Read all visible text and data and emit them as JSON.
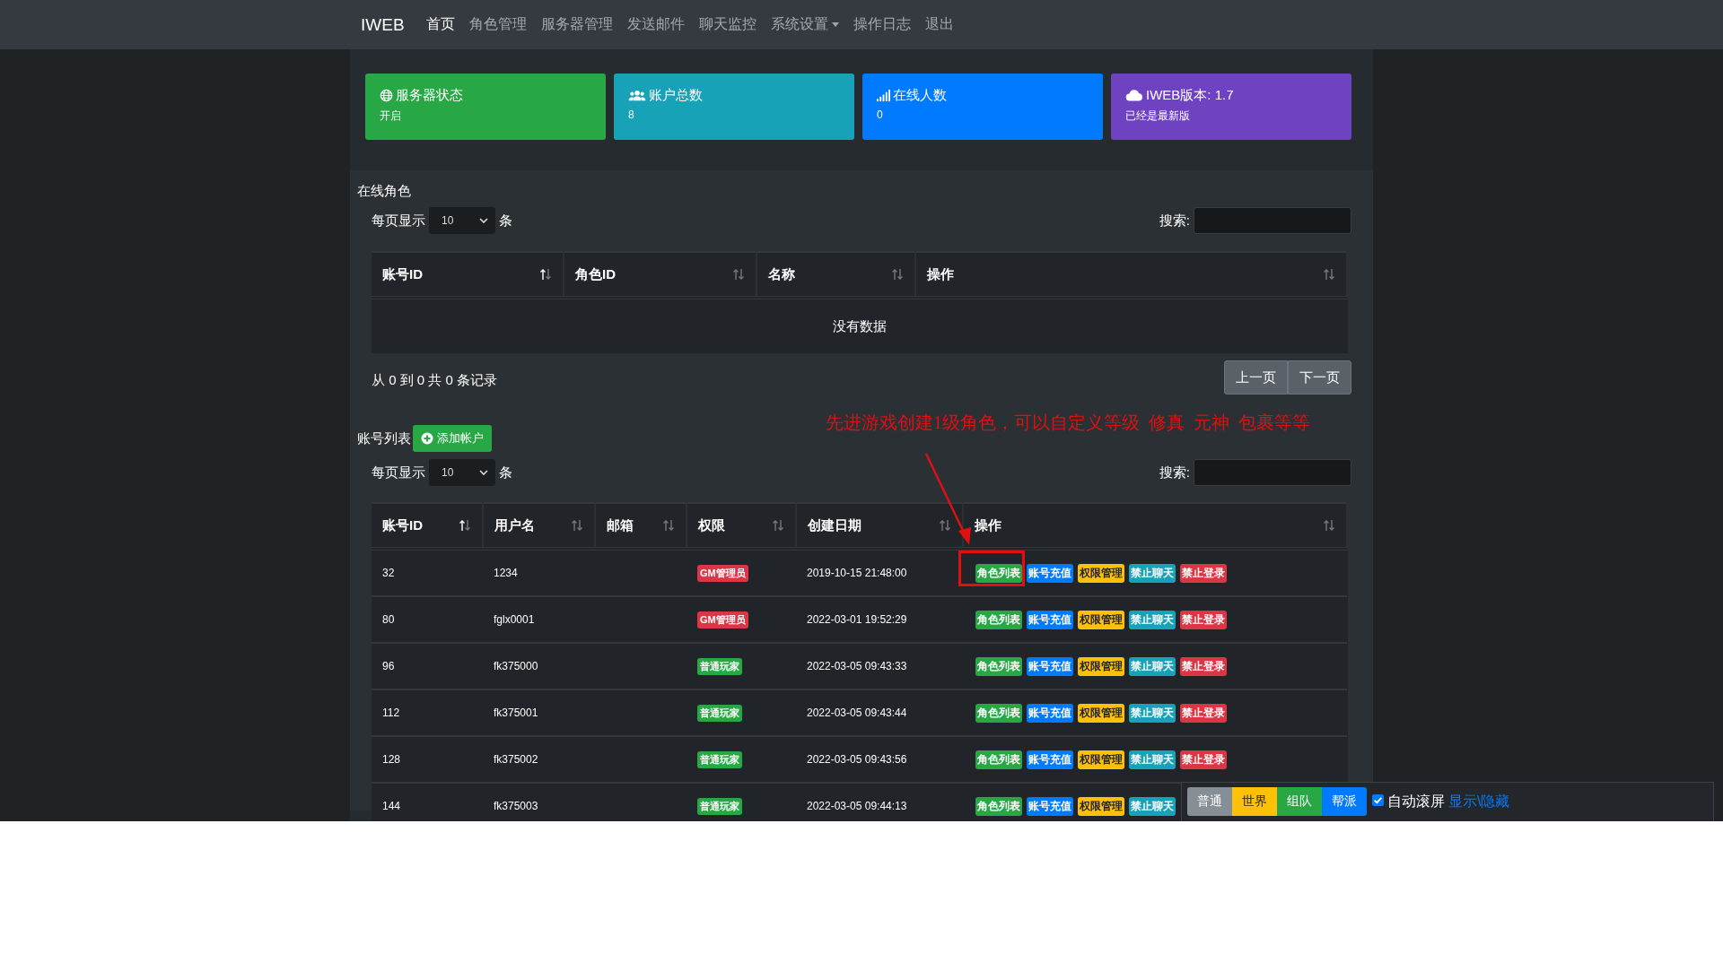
{
  "nav": {
    "brand": "IWEB",
    "items": [
      {
        "label": "首页",
        "selected": true,
        "dropdown": false
      },
      {
        "label": "角色管理",
        "selected": false,
        "dropdown": false
      },
      {
        "label": "服务器管理",
        "selected": false,
        "dropdown": false
      },
      {
        "label": "发送邮件",
        "selected": false,
        "dropdown": false
      },
      {
        "label": "聊天监控",
        "selected": false,
        "dropdown": false
      },
      {
        "label": "系统设置",
        "selected": false,
        "dropdown": true
      },
      {
        "label": "操作日志",
        "selected": false,
        "dropdown": false
      },
      {
        "label": "退出",
        "selected": false,
        "dropdown": false
      }
    ]
  },
  "cards": [
    {
      "kind": "globe",
      "title": "服务器状态",
      "value": "开启",
      "color": "#28a745"
    },
    {
      "kind": "users",
      "title": "账户总数",
      "value": "8",
      "color": "#17a2b8"
    },
    {
      "kind": "signal",
      "title": "在线人数",
      "value": "0",
      "color": "#007bff"
    },
    {
      "kind": "cloud",
      "title": "IWEB版本: 1.7",
      "value": "已经是最新版",
      "color": "#6f42c1"
    }
  ],
  "online_roles": {
    "title": "在线角色",
    "length_before": "每页显示",
    "length_value": "10",
    "length_after": "条",
    "search_label": "搜索:",
    "columns": [
      {
        "label": "账号ID",
        "sorted": true
      },
      {
        "label": "角色ID",
        "sorted": false
      },
      {
        "label": "名称",
        "sorted": false
      },
      {
        "label": "操作",
        "sorted": false
      }
    ],
    "empty": "没有数据",
    "info": "从 0 到 0 共 0 条记录",
    "buttons": [
      "上一页",
      "下一页"
    ]
  },
  "accounts": {
    "title": "账号列表",
    "add_button": "添加帐户",
    "annotation": "先进游戏创建1级角色，可以自定义等级  修真  元神  包裹等等",
    "length_before": "每页显示",
    "length_value": "10",
    "length_after": "条",
    "search_label": "搜索:",
    "columns": [
      {
        "label": "账号ID",
        "sorted": true
      },
      {
        "label": "用户名",
        "sorted": false
      },
      {
        "label": "邮箱",
        "sorted": false
      },
      {
        "label": "权限",
        "sorted": false
      },
      {
        "label": "创建日期",
        "sorted": false
      },
      {
        "label": "操作",
        "sorted": false
      }
    ],
    "rows": [
      {
        "id": "32",
        "username": "1234",
        "role": {
          "label": "GM管理员",
          "kind": "gm"
        },
        "created": "2019-10-15 21:48:00",
        "actions": [
          {
            "label": "角色列表",
            "kind": "list"
          },
          {
            "label": "账号充值",
            "kind": "recharge"
          },
          {
            "label": "权限管理",
            "kind": "permission"
          },
          {
            "label": "禁止聊天",
            "kind": "mute"
          },
          {
            "label": "禁止登录",
            "kind": "ban"
          }
        ]
      },
      {
        "id": "80",
        "username": "fglx0001",
        "role": {
          "label": "GM管理员",
          "kind": "gm"
        },
        "created": "2022-03-01 19:52:29",
        "actions": [
          {
            "label": "角色列表",
            "kind": "list"
          },
          {
            "label": "账号充值",
            "kind": "recharge"
          },
          {
            "label": "权限管理",
            "kind": "permission"
          },
          {
            "label": "禁止聊天",
            "kind": "mute"
          },
          {
            "label": "禁止登录",
            "kind": "ban"
          }
        ]
      },
      {
        "id": "96",
        "username": "fk375000",
        "role": {
          "label": "普通玩家",
          "kind": "player"
        },
        "created": "2022-03-05 09:43:33",
        "actions": [
          {
            "label": "角色列表",
            "kind": "list"
          },
          {
            "label": "账号充值",
            "kind": "recharge"
          },
          {
            "label": "权限管理",
            "kind": "permission"
          },
          {
            "label": "禁止聊天",
            "kind": "mute"
          },
          {
            "label": "禁止登录",
            "kind": "ban"
          }
        ]
      },
      {
        "id": "112",
        "username": "fk375001",
        "role": {
          "label": "普通玩家",
          "kind": "player"
        },
        "created": "2022-03-05 09:43:44",
        "actions": [
          {
            "label": "角色列表",
            "kind": "list"
          },
          {
            "label": "账号充值",
            "kind": "recharge"
          },
          {
            "label": "权限管理",
            "kind": "permission"
          },
          {
            "label": "禁止聊天",
            "kind": "mute"
          },
          {
            "label": "禁止登录",
            "kind": "ban"
          }
        ]
      },
      {
        "id": "128",
        "username": "fk375002",
        "role": {
          "label": "普通玩家",
          "kind": "player"
        },
        "created": "2022-03-05 09:43:56",
        "actions": [
          {
            "label": "角色列表",
            "kind": "list"
          },
          {
            "label": "账号充值",
            "kind": "recharge"
          },
          {
            "label": "权限管理",
            "kind": "permission"
          },
          {
            "label": "禁止聊天",
            "kind": "mute"
          },
          {
            "label": "禁止登录",
            "kind": "ban"
          }
        ]
      },
      {
        "id": "144",
        "username": "fk375003",
        "role": {
          "label": "普通玩家",
          "kind": "player"
        },
        "created": "2022-03-05 09:44:13",
        "actions": [
          {
            "label": "角色列表",
            "kind": "list"
          },
          {
            "label": "账号充值",
            "kind": "recharge"
          },
          {
            "label": "权限管理",
            "kind": "permission"
          },
          {
            "label": "禁止聊天",
            "kind": "mute"
          }
        ]
      }
    ]
  },
  "chat_bar": {
    "channels": [
      {
        "label": "普通",
        "kind": "normal"
      },
      {
        "label": "世界",
        "kind": "world"
      },
      {
        "label": "组队",
        "kind": "team"
      },
      {
        "label": "帮派",
        "kind": "guild"
      }
    ],
    "auto_scroll": {
      "label": "自动滚屏",
      "checked": true
    },
    "toggle_link": "显示\\隐藏"
  }
}
